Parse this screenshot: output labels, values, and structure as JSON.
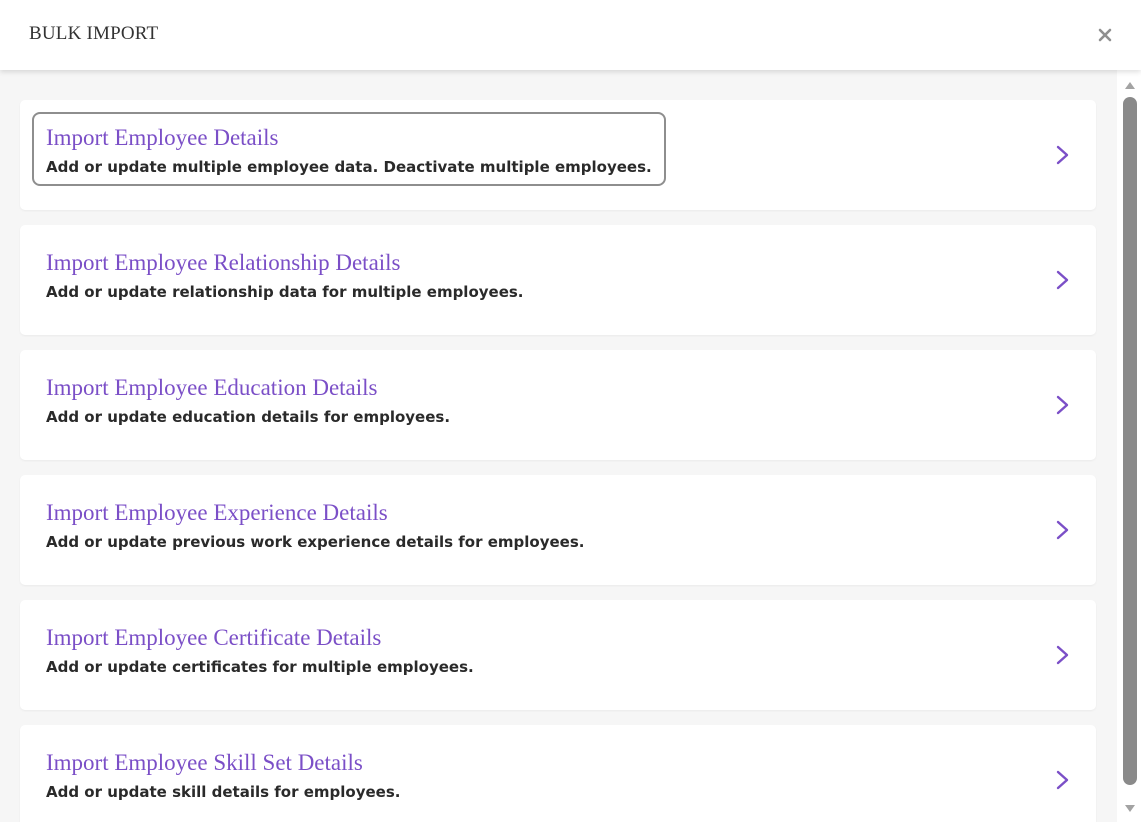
{
  "dialog": {
    "title": "BULK IMPORT",
    "close_icon": "close-icon"
  },
  "colors": {
    "title_accent": "#7b4fc7",
    "description": "#2a2a2a",
    "panel_background": "#f6f6f6",
    "focus_outline": "#8e8e8e"
  },
  "items": [
    {
      "title": "Import Employee Details",
      "description": "Add or update multiple employee data. Deactivate multiple employees.",
      "focused": true,
      "icon": "chevron-right-icon"
    },
    {
      "title": "Import Employee Relationship Details",
      "description": "Add or update relationship data for multiple employees.",
      "focused": false,
      "icon": "chevron-right-icon"
    },
    {
      "title": "Import Employee Education Details",
      "description": "Add or update education details for employees.",
      "focused": false,
      "icon": "chevron-right-icon"
    },
    {
      "title": "Import Employee Experience Details",
      "description": "Add or update previous work experience details for employees.",
      "focused": false,
      "icon": "chevron-right-icon"
    },
    {
      "title": "Import Employee Certificate Details",
      "description": "Add or update certificates for multiple employees.",
      "focused": false,
      "icon": "chevron-right-icon"
    },
    {
      "title": "Import Employee Skill Set Details",
      "description": "Add or update skill details for employees.",
      "focused": false,
      "icon": "chevron-right-icon"
    }
  ]
}
